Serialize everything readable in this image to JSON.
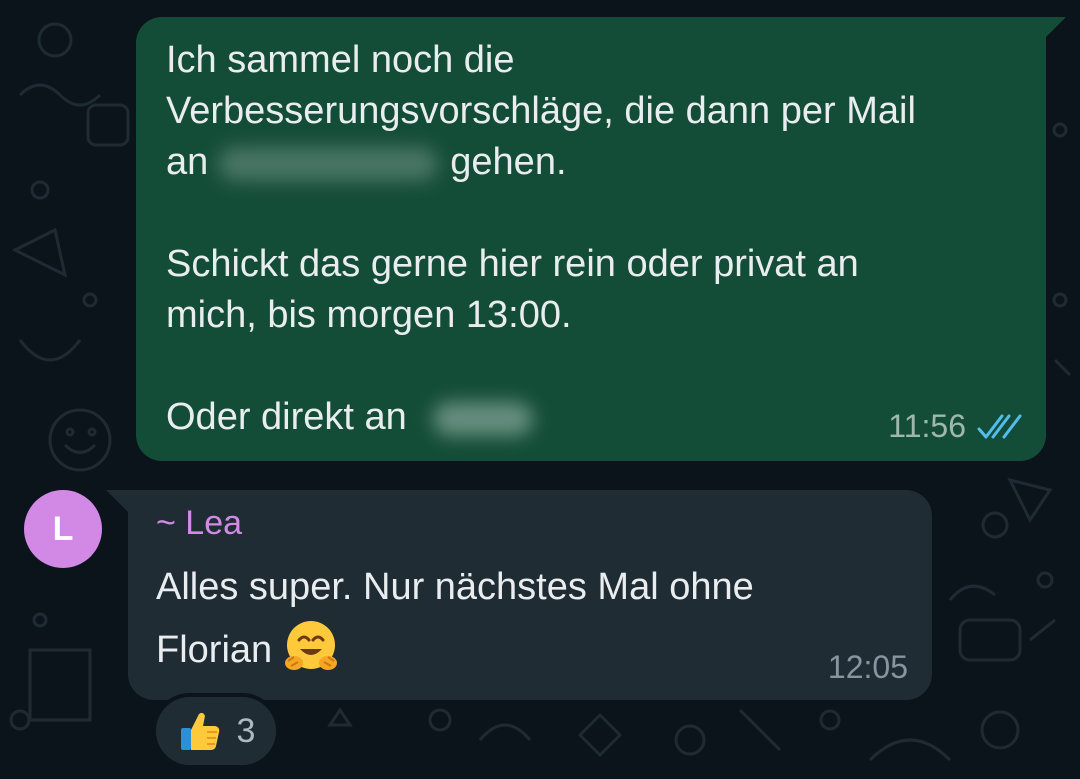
{
  "messages": {
    "outgoing": {
      "line1": "Ich sammel noch die",
      "line2": "Verbesserungsvorschläge, die dann per Mail",
      "line3_prefix": "an",
      "line3_suffix": "gehen.",
      "para2_line1": "Schickt das gerne hier rein oder privat an",
      "para2_line2": "mich, bis morgen 13:00.",
      "para3_prefix": "Oder direkt an",
      "time": "11:56",
      "status_icon": "double-check-read-icon"
    },
    "incoming": {
      "sender": "~ Lea",
      "avatar_initial": "L",
      "line1": "Alles super. Nur nächstes Mal ohne",
      "line2": "Florian",
      "emoji": "hugging-face-emoji",
      "time": "12:05",
      "reaction": {
        "emoji": "thumbs-up-emoji",
        "count": "3"
      }
    }
  },
  "colors": {
    "background": "#0b141a",
    "outgoing_bubble": "#144d37",
    "incoming_bubble": "#202c33",
    "sender_name": "#d08be6",
    "avatar": "#d289e6",
    "read_ticks": "#53bdeb"
  }
}
